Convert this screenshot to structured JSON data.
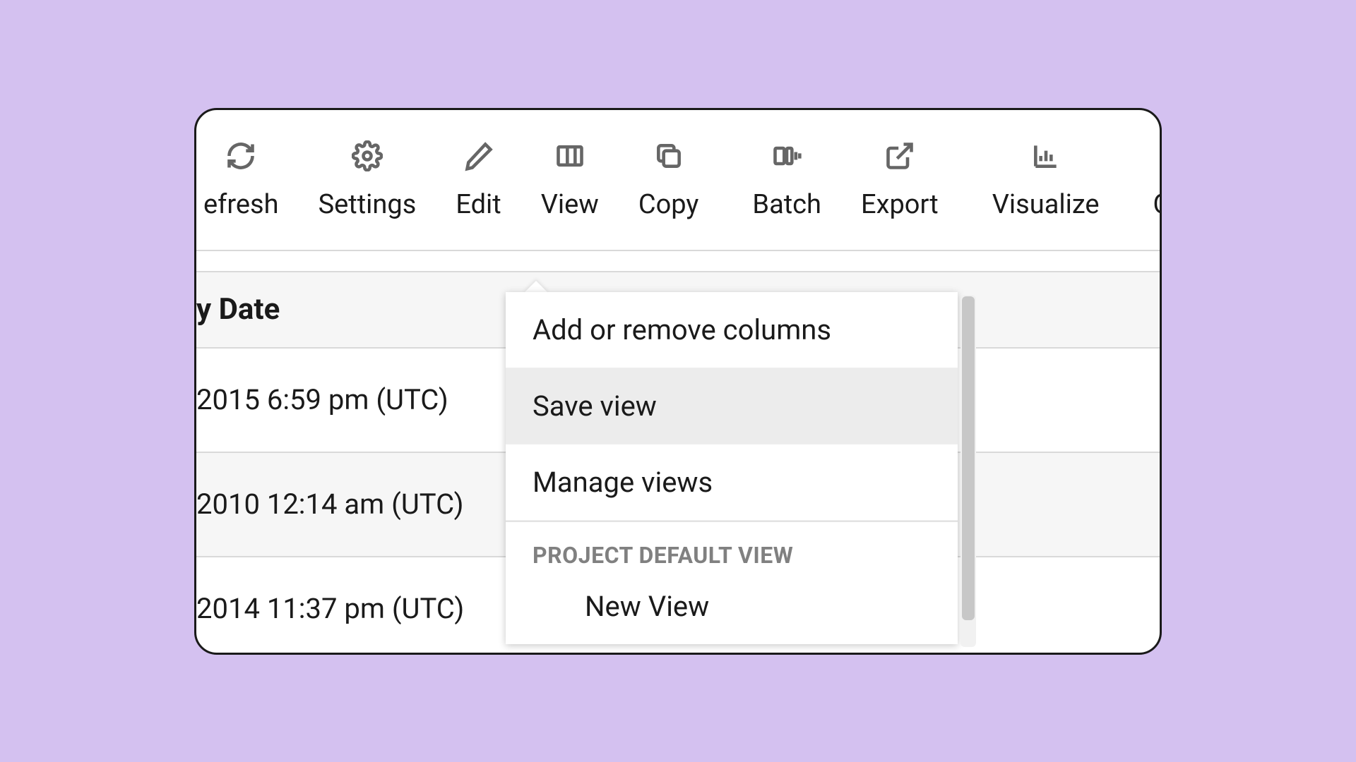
{
  "toolbar": {
    "refresh": "efresh",
    "settings": "Settings",
    "edit": "Edit",
    "view": "View",
    "copy": "Copy",
    "batch": "Batch",
    "export": "Export",
    "visualize": "Visualize",
    "quick": "Qui"
  },
  "table": {
    "header": "y Date",
    "rows": [
      "2015 6:59 pm (UTC)",
      "2010 12:14 am (UTC)",
      "2014 11:37 pm (UTC)"
    ]
  },
  "dropdown": {
    "items": [
      "Add or remove columns",
      "Save view",
      "Manage views"
    ],
    "section_label": "PROJECT DEFAULT VIEW",
    "subitem": "New View"
  }
}
